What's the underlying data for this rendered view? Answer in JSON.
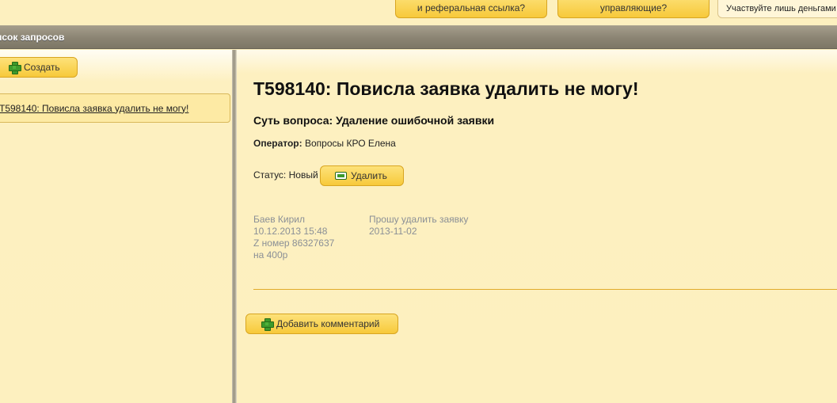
{
  "top_nav": {
    "btn1_label": "и реферальная ссылка?",
    "btn2_label": "управляющие?",
    "btn3_label": "Участвуйте лишь деньгами"
  },
  "header": {
    "title": "исок запросов"
  },
  "sidebar": {
    "create_label": "Создать",
    "requests": [
      {
        "label": "T598140: Повисла заявка удалить не могу!"
      }
    ]
  },
  "ticket": {
    "title": "T598140: Повисла заявка удалить не могу!",
    "subject": "Суть вопроса: Удаление ошибочной заявки",
    "operator_label": "Оператор:",
    "operator_value": "Вопросы КРО Елена",
    "status_label": "Статус: Новый",
    "delete_label": "Удалить",
    "message": {
      "author": "Баев Кирил",
      "datetime": "10.12.2013 15:48",
      "z_number": "Z номер 86327637",
      "amount": "на 400р",
      "text_line1": "Прошу удалить заявку",
      "text_line2": "2013-11-02"
    },
    "add_comment_label": "Добавить комментарий"
  },
  "icons": {
    "create": "plus-icon",
    "delete": "minus-icon",
    "add_comment": "plus-icon"
  }
}
